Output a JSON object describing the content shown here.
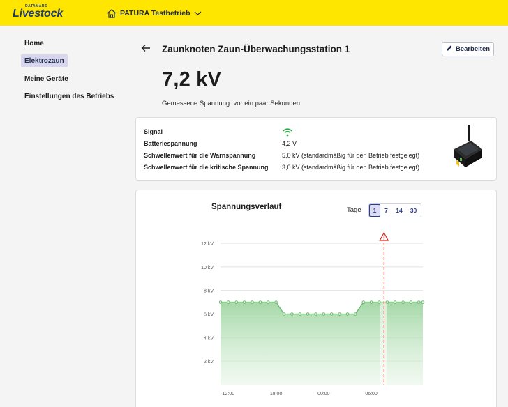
{
  "header": {
    "brand_small": "DATAMARS",
    "brand_big": "Livestock",
    "farm_name": "PATURA Testbetrieb",
    "farm_icon": "farm-house-icon",
    "dropdown_icon": "chevron-down-icon"
  },
  "sidebar": {
    "items": [
      {
        "label": "Home",
        "active": false
      },
      {
        "label": "Elektrozaun",
        "active": true
      },
      {
        "label": "Meine Geräte",
        "active": false
      },
      {
        "label": "Einstellungen des Betriebs",
        "active": false
      }
    ]
  },
  "main": {
    "title": "Zaunknoten Zaun-Überwachungsstation 1",
    "edit_label": "Bearbeiten",
    "voltage_value": "7,2 kV",
    "measured_text": "Gemessene Spannung: vor ein paar Sekunden"
  },
  "info": {
    "signal_label": "Signal",
    "signal_icon": "wifi-signal-icon",
    "battery_label": "Batteriespannung",
    "battery_value": "4,2 V",
    "warn_label": "Schwellenwert für die Warnspannung",
    "warn_value": "5,0 kV (standardmäßig für den Betrieb festgelegt)",
    "critical_label": "Schwellenwert für die kritische Spannung",
    "critical_value": "3,0 kV (standardmäßig für den Betrieb festgelegt)"
  },
  "colors": {
    "topbar": "#ffe600",
    "brand": "#1f3b7a",
    "line": "#67b86b",
    "fill": "#bfe3c0",
    "alert": "#e0261b",
    "signal": "#2ea84b"
  },
  "chart_section": {
    "title": "Spannungsverlauf",
    "days_label": "Tage",
    "ranges": [
      "1",
      "7",
      "14",
      "30"
    ],
    "active_range": "1"
  },
  "chart_data": {
    "type": "area",
    "title": "Spannungsverlauf",
    "x_ticks": [
      "12:00",
      "18:00",
      "00:00",
      "06:00"
    ],
    "y_ticks": [
      "2 kV",
      "4 kV",
      "6 kV",
      "8 kV",
      "10 kV",
      "12 kV"
    ],
    "ylim": [
      0,
      12
    ],
    "xlim_hours": [
      11,
      36.5
    ],
    "grid": true,
    "series": [
      {
        "x_hours": [
          11,
          12,
          13,
          14,
          15,
          16,
          17,
          18,
          19,
          20,
          21,
          22,
          23,
          24,
          25,
          26,
          27,
          28,
          29,
          30,
          31,
          32,
          33,
          34,
          35,
          36,
          37
        ],
        "values": [
          7.0,
          7.0,
          7.0,
          7.0,
          7.0,
          7.0,
          7.0,
          7.0,
          6.0,
          6.0,
          6.0,
          6.0,
          6.0,
          6.0,
          6.0,
          6.0,
          6.0,
          6.0,
          7.0,
          7.0,
          7.0,
          7.0,
          7.0,
          7.0,
          7.0,
          7.0,
          7.0
        ]
      }
    ],
    "alert_marker_hour": 31.6,
    "alert_icon": "warning-triangle-icon"
  }
}
